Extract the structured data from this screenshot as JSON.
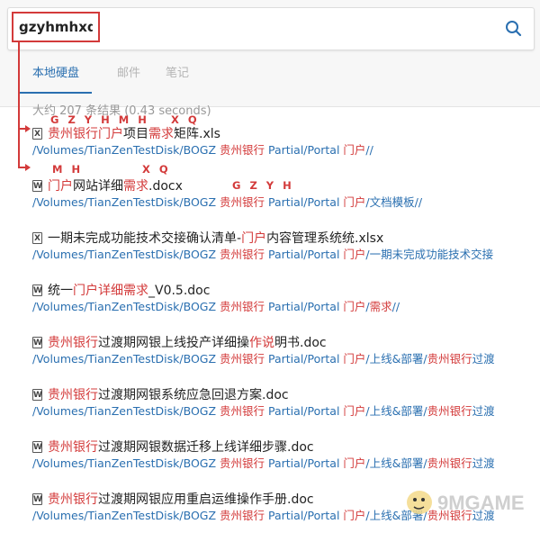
{
  "search": {
    "query": "gzyhmhxq"
  },
  "tabs": [
    {
      "label": "本地硬盘",
      "active": true
    },
    {
      "label": "邮件",
      "active": false
    },
    {
      "label": "笔记",
      "active": false
    }
  ],
  "stats": "大约 207 条结果 (0.43 seconds)",
  "annotations": {
    "result1_a": "G Z Y H M H",
    "result1_b": "X Q",
    "result2_a": "M H",
    "result2_b": "X Q",
    "result2_c": "G Z Y H"
  },
  "results": [
    {
      "icon": "excel-file-icon",
      "icon_letter": "X",
      "title": [
        {
          "t": "贵州银行",
          "hl": true
        },
        {
          "t": "门户",
          "hl": true
        },
        {
          "t": "项目",
          "hl": false
        },
        {
          "t": "需求",
          "hl": true
        },
        {
          "t": "矩阵.xls",
          "hl": false
        }
      ],
      "path": [
        {
          "t": "/Volumes/TianZenTestDisk/BOGZ ",
          "hl": false
        },
        {
          "t": "贵州银行",
          "hl": true
        },
        {
          "t": " Partial/Portal ",
          "hl": false
        },
        {
          "t": "门户",
          "hl": true
        },
        {
          "t": "//",
          "hl": false
        }
      ]
    },
    {
      "icon": "word-file-icon",
      "icon_letter": "W",
      "title": [
        {
          "t": "门户",
          "hl": true
        },
        {
          "t": "网站详细",
          "hl": false
        },
        {
          "t": "需求",
          "hl": true
        },
        {
          "t": ".docx",
          "hl": false
        }
      ],
      "path": [
        {
          "t": "/Volumes/TianZenTestDisk/BOGZ ",
          "hl": false
        },
        {
          "t": "贵州银行",
          "hl": true
        },
        {
          "t": " Partial/Portal ",
          "hl": false
        },
        {
          "t": "门户",
          "hl": true
        },
        {
          "t": "/文档模板//",
          "hl": false
        }
      ]
    },
    {
      "icon": "excel-file-icon",
      "icon_letter": "X",
      "title": [
        {
          "t": "一期未完成功能技术交接确认清单-",
          "hl": false
        },
        {
          "t": "门户",
          "hl": true
        },
        {
          "t": "内容管理系统统.xlsx",
          "hl": false
        }
      ],
      "path": [
        {
          "t": "/Volumes/TianZenTestDisk/BOGZ ",
          "hl": false
        },
        {
          "t": "贵州银行",
          "hl": true
        },
        {
          "t": " Partial/Portal ",
          "hl": false
        },
        {
          "t": "门户",
          "hl": true
        },
        {
          "t": "/一期未完成功能技术交接",
          "hl": false
        }
      ]
    },
    {
      "icon": "word-file-icon",
      "icon_letter": "W",
      "title": [
        {
          "t": "统一",
          "hl": false
        },
        {
          "t": "门户详细",
          "hl": true
        },
        {
          "t": "需求",
          "hl": true
        },
        {
          "t": "_V0.5.doc",
          "hl": false
        }
      ],
      "path": [
        {
          "t": "/Volumes/TianZenTestDisk/BOGZ ",
          "hl": false
        },
        {
          "t": "贵州银行",
          "hl": true
        },
        {
          "t": " Partial/Portal ",
          "hl": false
        },
        {
          "t": "门户",
          "hl": true
        },
        {
          "t": "/",
          "hl": false
        },
        {
          "t": "需求",
          "hl": true
        },
        {
          "t": "//",
          "hl": false
        }
      ]
    },
    {
      "icon": "word-file-icon",
      "icon_letter": "W",
      "title": [
        {
          "t": "贵州银行",
          "hl": true
        },
        {
          "t": "过渡期网银上线投产详细操",
          "hl": false
        },
        {
          "t": "作说",
          "hl": true
        },
        {
          "t": "明书.doc",
          "hl": false
        }
      ],
      "path": [
        {
          "t": "/Volumes/TianZenTestDisk/BOGZ ",
          "hl": false
        },
        {
          "t": "贵州银行",
          "hl": true
        },
        {
          "t": " Partial/Portal ",
          "hl": false
        },
        {
          "t": "门户",
          "hl": true
        },
        {
          "t": "/上线&部署/",
          "hl": false
        },
        {
          "t": "贵州银行",
          "hl": true
        },
        {
          "t": "过渡",
          "hl": false
        }
      ]
    },
    {
      "icon": "word-file-icon",
      "icon_letter": "W",
      "title": [
        {
          "t": "贵州银行",
          "hl": true
        },
        {
          "t": "过渡期网银系统应急回退方案.doc",
          "hl": false
        }
      ],
      "path": [
        {
          "t": "/Volumes/TianZenTestDisk/BOGZ ",
          "hl": false
        },
        {
          "t": "贵州银行",
          "hl": true
        },
        {
          "t": " Partial/Portal ",
          "hl": false
        },
        {
          "t": "门户",
          "hl": true
        },
        {
          "t": "/上线&部署/",
          "hl": false
        },
        {
          "t": "贵州银行",
          "hl": true
        },
        {
          "t": "过渡",
          "hl": false
        }
      ]
    },
    {
      "icon": "word-file-icon",
      "icon_letter": "W",
      "title": [
        {
          "t": "贵州银行",
          "hl": true
        },
        {
          "t": "过渡期网银数据迁移上线详细步骤.doc",
          "hl": false
        }
      ],
      "path": [
        {
          "t": "/Volumes/TianZenTestDisk/BOGZ ",
          "hl": false
        },
        {
          "t": "贵州银行",
          "hl": true
        },
        {
          "t": " Partial/Portal ",
          "hl": false
        },
        {
          "t": "门户",
          "hl": true
        },
        {
          "t": "/上线&部署/",
          "hl": false
        },
        {
          "t": "贵州银行",
          "hl": true
        },
        {
          "t": "过渡",
          "hl": false
        }
      ]
    },
    {
      "icon": "word-file-icon",
      "icon_letter": "W",
      "title": [
        {
          "t": "贵州银行",
          "hl": true
        },
        {
          "t": "过渡期网银应用重启运维操作手册.doc",
          "hl": false
        }
      ],
      "path": [
        {
          "t": "/Volumes/TianZenTestDisk/BOGZ ",
          "hl": false
        },
        {
          "t": "贵州银行",
          "hl": true
        },
        {
          "t": " Partial/Portal ",
          "hl": false
        },
        {
          "t": "门户",
          "hl": true
        },
        {
          "t": "/上线&部署/",
          "hl": false
        },
        {
          "t": "贵州银行",
          "hl": true
        },
        {
          "t": "过渡",
          "hl": false
        }
      ]
    }
  ],
  "watermark": {
    "text": "9MGAME",
    "icon": "mascot-watermark-icon"
  },
  "colors": {
    "highlight": "#d33a3a",
    "link": "#2a6fb0",
    "tab_active": "#2a6fb0"
  }
}
